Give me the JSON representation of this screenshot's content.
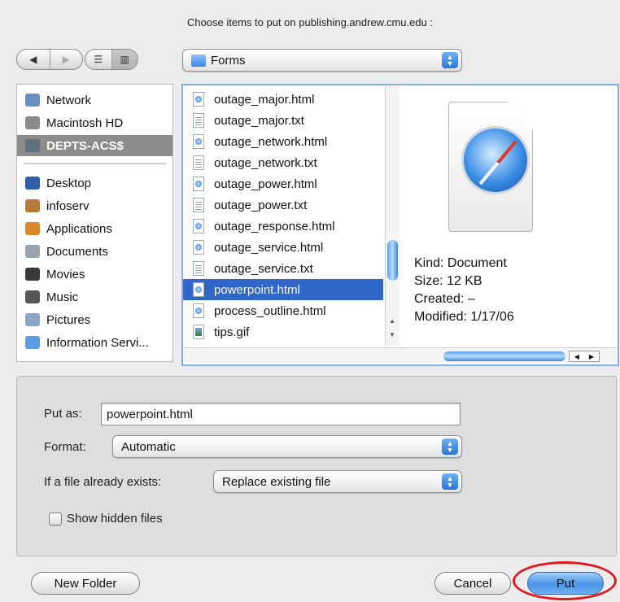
{
  "dialog": {
    "title": "Choose items to put on publishing.andrew.cmu.edu :"
  },
  "toolbar": {
    "back_glyph": "◀",
    "forward_glyph": "▶",
    "list_view_glyph": "☰",
    "column_view_glyph": "▥",
    "location": "Forms"
  },
  "sidebar": {
    "items": [
      {
        "label": "Network",
        "icon": "network-icon",
        "color": "#6a8fbf"
      },
      {
        "label": "Macintosh HD",
        "icon": "hard-drive-icon",
        "color": "#8a8a8a"
      },
      {
        "label": "DEPTS-ACS$",
        "icon": "server-icon",
        "color": "#5f6f80",
        "selected": true
      },
      {
        "label": "Desktop",
        "icon": "desktop-icon",
        "color": "#2f5fa8"
      },
      {
        "label": "infoserv",
        "icon": "home-icon",
        "color": "#b87a3a"
      },
      {
        "label": "Applications",
        "icon": "applications-icon",
        "color": "#d88a2a"
      },
      {
        "label": "Documents",
        "icon": "documents-icon",
        "color": "#9aa3ad"
      },
      {
        "label": "Movies",
        "icon": "movies-icon",
        "color": "#3a3a3a"
      },
      {
        "label": "Music",
        "icon": "music-icon",
        "color": "#555555"
      },
      {
        "label": "Pictures",
        "icon": "pictures-icon",
        "color": "#8aa6c8"
      },
      {
        "label": "Information Servi...",
        "icon": "folder-icon",
        "color": "#5b9be0"
      }
    ]
  },
  "files": [
    {
      "name": "outage_major.html",
      "type": "html"
    },
    {
      "name": "outage_major.txt",
      "type": "txt"
    },
    {
      "name": "outage_network.html",
      "type": "html"
    },
    {
      "name": "outage_network.txt",
      "type": "txt"
    },
    {
      "name": "outage_power.html",
      "type": "html"
    },
    {
      "name": "outage_power.txt",
      "type": "txt"
    },
    {
      "name": "outage_response.html",
      "type": "html"
    },
    {
      "name": "outage_service.html",
      "type": "html"
    },
    {
      "name": "outage_service.txt",
      "type": "txt"
    },
    {
      "name": "powerpoint.html",
      "type": "html",
      "selected": true
    },
    {
      "name": "process_outline.html",
      "type": "html"
    },
    {
      "name": "tips.gif",
      "type": "gif"
    }
  ],
  "preview": {
    "kind": "Kind: Document",
    "size": "Size: 12 KB",
    "created": "Created: –",
    "modified": "Modified: 1/17/06"
  },
  "options": {
    "put_as_label": "Put as:",
    "put_as_value": "powerpoint.html",
    "format_label": "Format:",
    "format_value": "Automatic",
    "exists_label": "If a file already exists:",
    "exists_value": "Replace existing file",
    "show_hidden_label": "Show hidden files"
  },
  "buttons": {
    "new_folder": "New Folder",
    "cancel": "Cancel",
    "put": "Put"
  },
  "colors": {
    "selection": "#2f66c7",
    "sidebar_selection": "#8c8c8c",
    "highlight_ring": "#e0181f"
  }
}
